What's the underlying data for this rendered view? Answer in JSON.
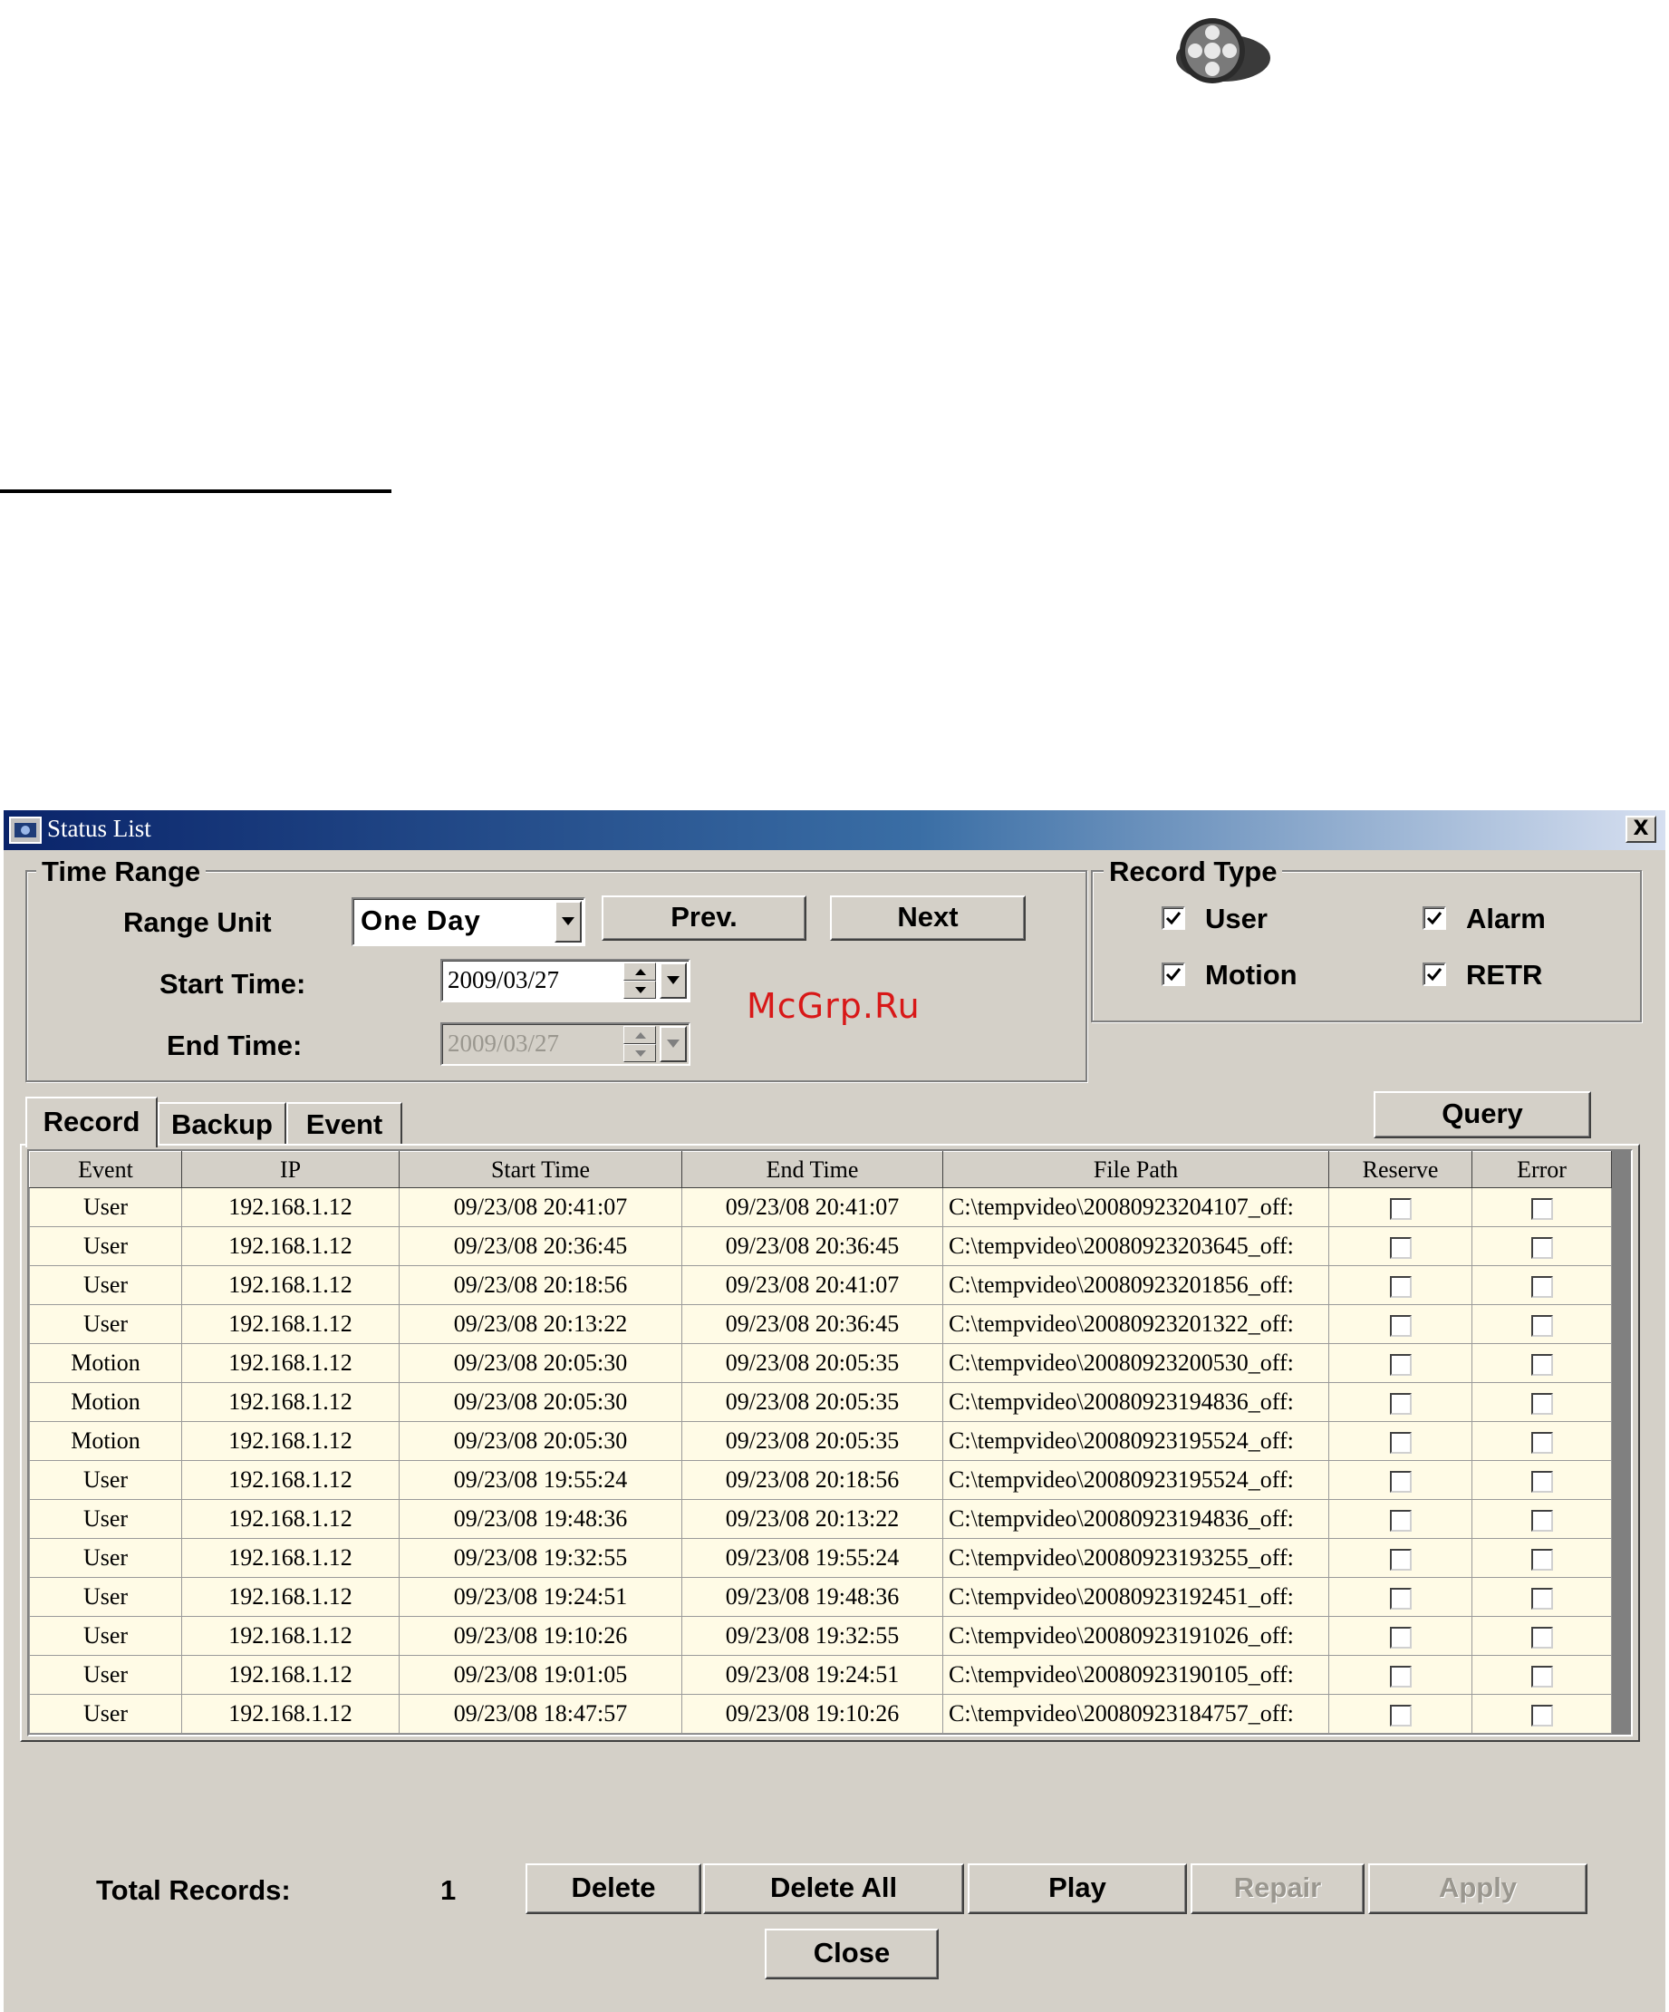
{
  "window": {
    "title": "Status List",
    "close_label": "X"
  },
  "watermark": "McGrp.Ru",
  "time_range": {
    "legend": "Time Range",
    "range_unit_label": "Range Unit",
    "range_unit_value": "One Day",
    "prev_label": "Prev.",
    "next_label": "Next",
    "start_label": "Start Time:",
    "start_value": "2009/03/27",
    "end_label": "End Time:",
    "end_value": "2009/03/27"
  },
  "record_type": {
    "legend": "Record Type",
    "items": [
      {
        "label": "User",
        "checked": true
      },
      {
        "label": "Alarm",
        "checked": true
      },
      {
        "label": "Motion",
        "checked": true
      },
      {
        "label": "RETR",
        "checked": true
      }
    ]
  },
  "tabs": [
    "Record",
    "Backup",
    "Event"
  ],
  "query_label": "Query",
  "table": {
    "columns": [
      "Event",
      "IP",
      "Start Time",
      "End Time",
      "File Path",
      "Reserve",
      "Error"
    ],
    "rows": [
      [
        "User",
        "192.168.1.12",
        "09/23/08 20:41:07",
        "09/23/08 20:41:07",
        "C:\\tempvideo\\20080923204107_off:"
      ],
      [
        "User",
        "192.168.1.12",
        "09/23/08 20:36:45",
        "09/23/08 20:36:45",
        "C:\\tempvideo\\20080923203645_off:"
      ],
      [
        "User",
        "192.168.1.12",
        "09/23/08 20:18:56",
        "09/23/08 20:41:07",
        "C:\\tempvideo\\20080923201856_off:"
      ],
      [
        "User",
        "192.168.1.12",
        "09/23/08 20:13:22",
        "09/23/08 20:36:45",
        "C:\\tempvideo\\20080923201322_off:"
      ],
      [
        "Motion",
        "192.168.1.12",
        "09/23/08 20:05:30",
        "09/23/08 20:05:35",
        "C:\\tempvideo\\20080923200530_off:"
      ],
      [
        "Motion",
        "192.168.1.12",
        "09/23/08 20:05:30",
        "09/23/08 20:05:35",
        "C:\\tempvideo\\20080923194836_off:"
      ],
      [
        "Motion",
        "192.168.1.12",
        "09/23/08 20:05:30",
        "09/23/08 20:05:35",
        "C:\\tempvideo\\20080923195524_off:"
      ],
      [
        "User",
        "192.168.1.12",
        "09/23/08 19:55:24",
        "09/23/08 20:18:56",
        "C:\\tempvideo\\20080923195524_off:"
      ],
      [
        "User",
        "192.168.1.12",
        "09/23/08 19:48:36",
        "09/23/08 20:13:22",
        "C:\\tempvideo\\20080923194836_off:"
      ],
      [
        "User",
        "192.168.1.12",
        "09/23/08 19:32:55",
        "09/23/08 19:55:24",
        "C:\\tempvideo\\20080923193255_off:"
      ],
      [
        "User",
        "192.168.1.12",
        "09/23/08 19:24:51",
        "09/23/08 19:48:36",
        "C:\\tempvideo\\20080923192451_off:"
      ],
      [
        "User",
        "192.168.1.12",
        "09/23/08 19:10:26",
        "09/23/08 19:32:55",
        "C:\\tempvideo\\20080923191026_off:"
      ],
      [
        "User",
        "192.168.1.12",
        "09/23/08 19:01:05",
        "09/23/08 19:24:51",
        "C:\\tempvideo\\20080923190105_off:"
      ],
      [
        "User",
        "192.168.1.12",
        "09/23/08 18:47:57",
        "09/23/08 19:10:26",
        "C:\\tempvideo\\20080923184757_off:"
      ]
    ]
  },
  "footer": {
    "total_label": "Total Records:",
    "total_value": "1",
    "delete_label": "Delete",
    "delete_all_label": "Delete All",
    "play_label": "Play",
    "repair_label": "Repair",
    "apply_label": "Apply",
    "close_label": "Close"
  },
  "colors": {
    "title_start": "#0a246a",
    "title_end": "#d6dff0",
    "row_bg": "#fffbe6",
    "window_bg": "#d4d0c8"
  }
}
